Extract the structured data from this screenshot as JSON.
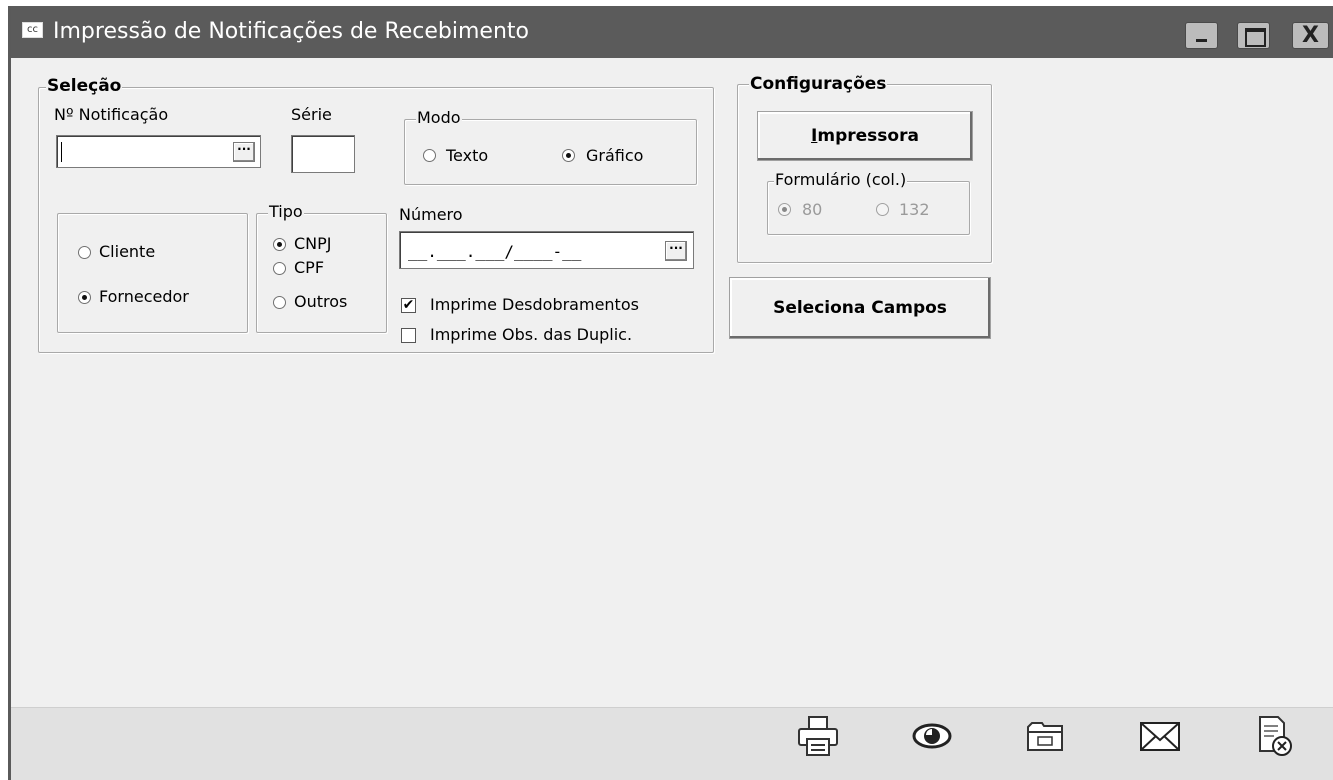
{
  "window": {
    "app_icon_text": "cc",
    "title": "Impressão de Notificações de Recebimento",
    "controls": [
      "minimize",
      "maximize",
      "close"
    ],
    "close_glyph": "X"
  },
  "selecao": {
    "legend": "Seleção",
    "notificacao_label": "Nº Notificação",
    "notificacao_value": "",
    "serie_label": "Série",
    "serie_value": "",
    "ellipsis": "···",
    "modo": {
      "legend": "Modo",
      "options": [
        "Texto",
        "Gráfico"
      ],
      "selected": "Gráfico"
    },
    "entidade": {
      "options": [
        "Cliente",
        "Fornecedor"
      ],
      "selected": "Fornecedor"
    },
    "tipo": {
      "legend": "Tipo",
      "options": [
        "CNPJ",
        "CPF",
        "Outros"
      ],
      "selected": "CNPJ"
    },
    "numero_label": "Número",
    "numero_mask": "__.___.___/____-__",
    "checkboxes": [
      {
        "label": "Imprime Desdobramentos",
        "checked": true
      },
      {
        "label": "Imprime Obs. das Duplic.",
        "checked": false
      }
    ]
  },
  "configuracoes": {
    "legend": "Configurações",
    "impressora_button": "Impressora",
    "impressora_mnemonic": "I",
    "formulario": {
      "legend": "Formulário (col.)",
      "options": [
        "80",
        "132"
      ],
      "selected": "80",
      "enabled": false
    }
  },
  "seleciona_campos_button": "Seleciona Campos",
  "toolbar_icons": [
    "printer-icon",
    "eye-icon",
    "folder-icon",
    "envelope-icon",
    "document-close-icon"
  ]
}
